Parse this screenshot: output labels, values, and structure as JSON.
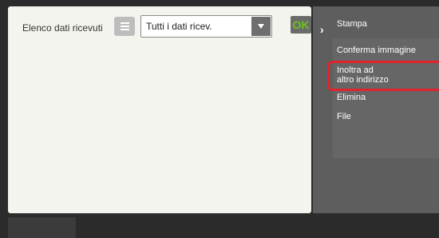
{
  "header": {
    "title": "Elenco dati ricevuti",
    "filter_selected": "Tutti i dati ricev.",
    "ok_label": "OK"
  },
  "action_menu": {
    "items": [
      {
        "label": "Stampa"
      },
      {
        "label": "Conferma immagine"
      },
      {
        "label": "Inoltra ad\naltro indirizzo",
        "highlighted": true
      },
      {
        "label": "Elimina"
      },
      {
        "label": "File"
      }
    ]
  },
  "icons": {
    "list_view": "list-icon",
    "dropdown": "chevron-down-icon",
    "expand": "chevron-right-icon"
  },
  "colors": {
    "ok_text": "#6dc21d",
    "highlight_border": "#e2232e",
    "side_panel": "#5e5e5e"
  }
}
